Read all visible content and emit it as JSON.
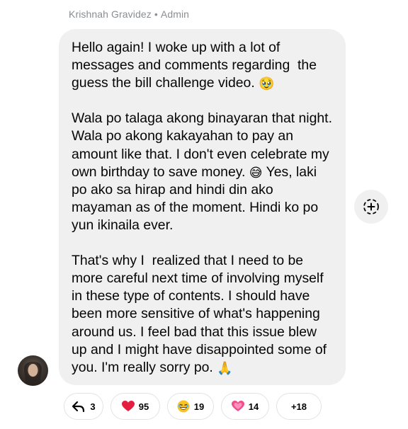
{
  "comment": {
    "author": "Krishnah Gravidez",
    "role": "Admin",
    "separator": "•",
    "paragraphs": [
      {
        "text": "Hello again! I woke up with a lot of messages and comments regarding  the guess the bill challenge video.",
        "emoji": "🥹"
      },
      {
        "text": "Wala po talaga akong binayaran that night. Wala po akong kakayahan to pay an amount like that. I don't even celebrate my own birthday to save money.",
        "emoji": "😅",
        "after": "Yes, laki po ako sa hirap and hindi din ako mayaman as of the moment. Hindi ko po yun ikinaila ever."
      },
      {
        "text": "That's why I  realized that I need to be more careful next time of involving myself in these type of contents. I should have been more sensitive of what's happening around us. I feel bad that this issue blew up and I might have disappointed some of you. I'm really sorry po.",
        "emoji": "🙏"
      }
    ]
  },
  "reactions": [
    {
      "icon": "reply-arrow-icon",
      "count": "3"
    },
    {
      "icon": "heart-icon",
      "count": "95",
      "color": "#e41e3f"
    },
    {
      "icon": "laugh-emoji-icon",
      "count": "19"
    },
    {
      "icon": "pink-heart-icon",
      "count": "14",
      "color": "#f04d8c"
    },
    {
      "label": "+18"
    }
  ],
  "colors": {
    "bubble": "#f0f0f0",
    "meta_text": "#8a8d91",
    "body_text": "#050505"
  }
}
